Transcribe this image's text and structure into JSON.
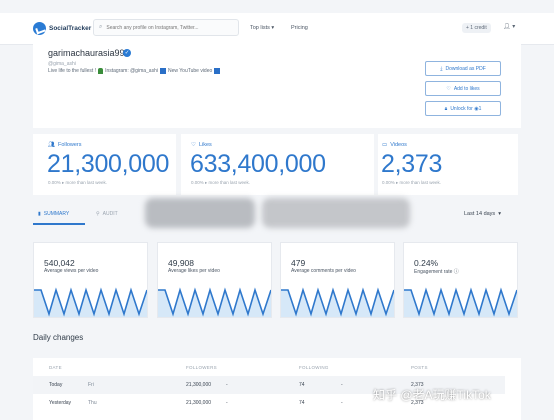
{
  "header": {
    "brand": "SocialTracker",
    "search_placeholder": "Search any profile on Instagram, Twitter...",
    "nav": [
      "Top lists ▾",
      "Pricing"
    ],
    "credit": "+ 1 credit",
    "user_menu": "▾"
  },
  "profile": {
    "name": "garimachaurasia996",
    "verified_mark": "✓",
    "handle": "@gima_ashi",
    "bio": [
      "Live life to the fullest !",
      "Instagram: @gima_ashi",
      "New YouTube video"
    ],
    "actions": [
      "Download as PDF",
      "Add to likes",
      "Unlock for ◉1"
    ]
  },
  "stats": [
    {
      "label": "Followers",
      "value": "21,300,000",
      "note": "0.00% ▸ more than last week."
    },
    {
      "label": "Likes",
      "value": "633,400,000",
      "note": "0.00% ▸ more than last week."
    },
    {
      "label": "Videos",
      "value": "2,373",
      "note": "0.00% ▸ more than last week."
    }
  ],
  "tabs": {
    "summary": "SUMMARY",
    "audit": "AUDIT",
    "period": "Last 14 days"
  },
  "metrics": [
    {
      "value": "540,042",
      "label": "Average views per video"
    },
    {
      "value": "49,908",
      "label": "Average likes per video"
    },
    {
      "value": "479",
      "label": "Average comments per video"
    },
    {
      "value": "0.24%",
      "label": "Engagement rate ⓘ"
    }
  ],
  "daily": {
    "title": "Daily changes",
    "columns": [
      "DATE",
      "FOLLOWERS",
      "FOLLOWING",
      "POSTS"
    ],
    "rows": [
      {
        "day": "Today",
        "dow": "Fri",
        "followers": "21,300,000",
        "fdelta": "-",
        "following": "74",
        "gdelta": "-",
        "posts": "2,373"
      },
      {
        "day": "Yesterday",
        "dow": "Thu",
        "followers": "21,300,000",
        "fdelta": "-",
        "following": "74",
        "gdelta": "-",
        "posts": "2,373"
      }
    ]
  },
  "watermark": "知乎 @老A玩赚TikTok",
  "colors": {
    "accent": "#2f78cc",
    "spark_fill": "#d6e8f8"
  }
}
